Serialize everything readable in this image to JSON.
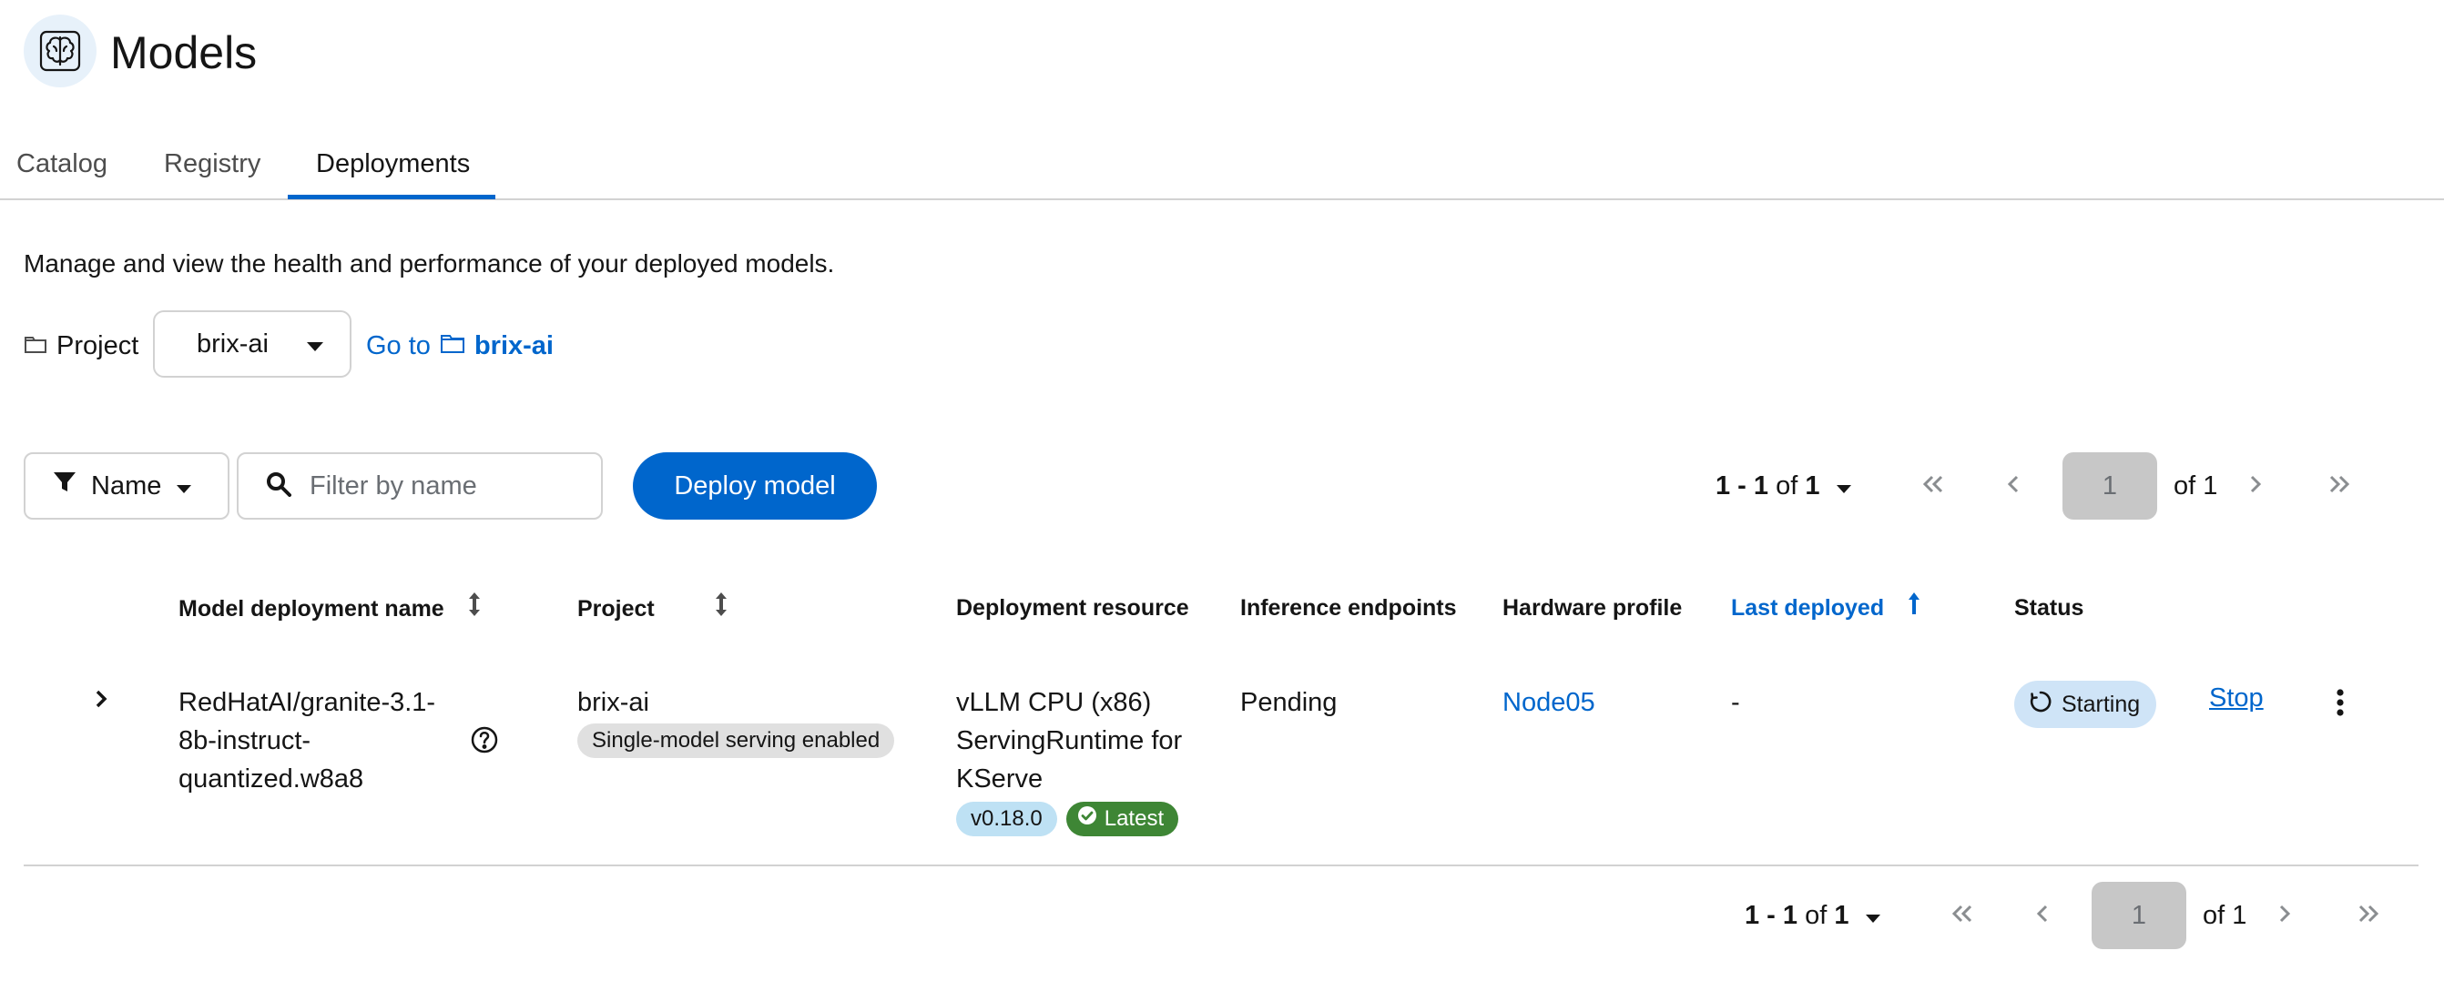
{
  "header": {
    "title": "Models",
    "icon": "brain-icon"
  },
  "tabs": [
    {
      "label": "Catalog",
      "active": false
    },
    {
      "label": "Registry",
      "active": false
    },
    {
      "label": "Deployments",
      "active": true
    }
  ],
  "description": "Manage and view the health and performance of your deployed models.",
  "project": {
    "label": "Project",
    "selected": "brix-ai",
    "goto_prefix": "Go to",
    "goto_project": "brix-ai"
  },
  "toolbar": {
    "filter_type": "Name",
    "filter_placeholder": "Filter by name",
    "deploy_label": "Deploy model"
  },
  "pagination": {
    "range": "1 - 1",
    "of_word": "of",
    "total": "1",
    "page": "1",
    "of_pages": "of 1"
  },
  "table": {
    "columns": [
      "Model deployment name",
      "Project",
      "Deployment resource",
      "Inference endpoints",
      "Hardware profile",
      "Last deployed",
      "Status"
    ],
    "sorted_column": "Last deployed",
    "rows": [
      {
        "name_lines": [
          "RedHatAI/granite-3.1-",
          "8b-instruct-",
          "quantized.w8a8"
        ],
        "project": "brix-ai",
        "project_badge": "Single-model serving enabled",
        "resource_lines": [
          "vLLM CPU (x86)",
          "ServingRuntime for",
          "KServe"
        ],
        "version_badge": "v0.18.0",
        "latest_badge": "Latest",
        "inference_endpoints": "Pending",
        "hardware_profile": "Node05",
        "last_deployed": "-",
        "status": "Starting",
        "action": "Stop"
      }
    ]
  },
  "colors": {
    "primary": "#0066cc",
    "success": "#3e8635",
    "status_bg": "#cfe4f7",
    "badge_grey": "#e0e0e0",
    "badge_blue": "#bee1f4"
  }
}
